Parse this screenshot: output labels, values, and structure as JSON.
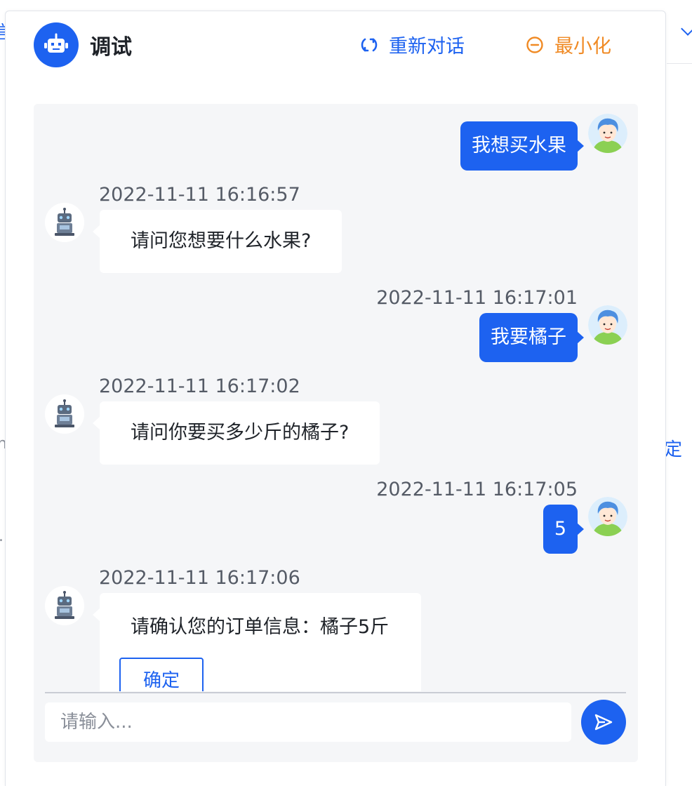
{
  "background": {
    "fragment_left_top": "信",
    "fragment_right_mid": "定",
    "fragment_left_mid": "n",
    "fragment_left_lower": "."
  },
  "header": {
    "title": "调试",
    "restart_label": "重新对话",
    "minimize_label": "最小化",
    "logo_icon": "robot-icon",
    "restart_icon": "refresh-icon",
    "minimize_icon": "minus-circle-icon"
  },
  "messages": [
    {
      "role": "user",
      "text": "我想买水果"
    },
    {
      "role": "bot",
      "time": "2022-11-11 16:16:57",
      "text": "请问您想要什么水果?"
    },
    {
      "role": "user",
      "time": "2022-11-11 16:17:01",
      "text": "我要橘子"
    },
    {
      "role": "bot",
      "time": "2022-11-11 16:17:02",
      "text": "请问你要买多少斤的橘子?"
    },
    {
      "role": "user",
      "time": "2022-11-11 16:17:05",
      "text": "5"
    },
    {
      "role": "bot",
      "time": "2022-11-11 16:17:06",
      "text": "请确认您的订单信息：橘子5斤",
      "button_label": "确定"
    }
  ],
  "composer": {
    "placeholder": "请输入...",
    "send_icon": "send-icon"
  },
  "colors": {
    "primary": "#1d62f0",
    "warning": "#f08a24",
    "chat_bg": "#f5f6f8"
  }
}
